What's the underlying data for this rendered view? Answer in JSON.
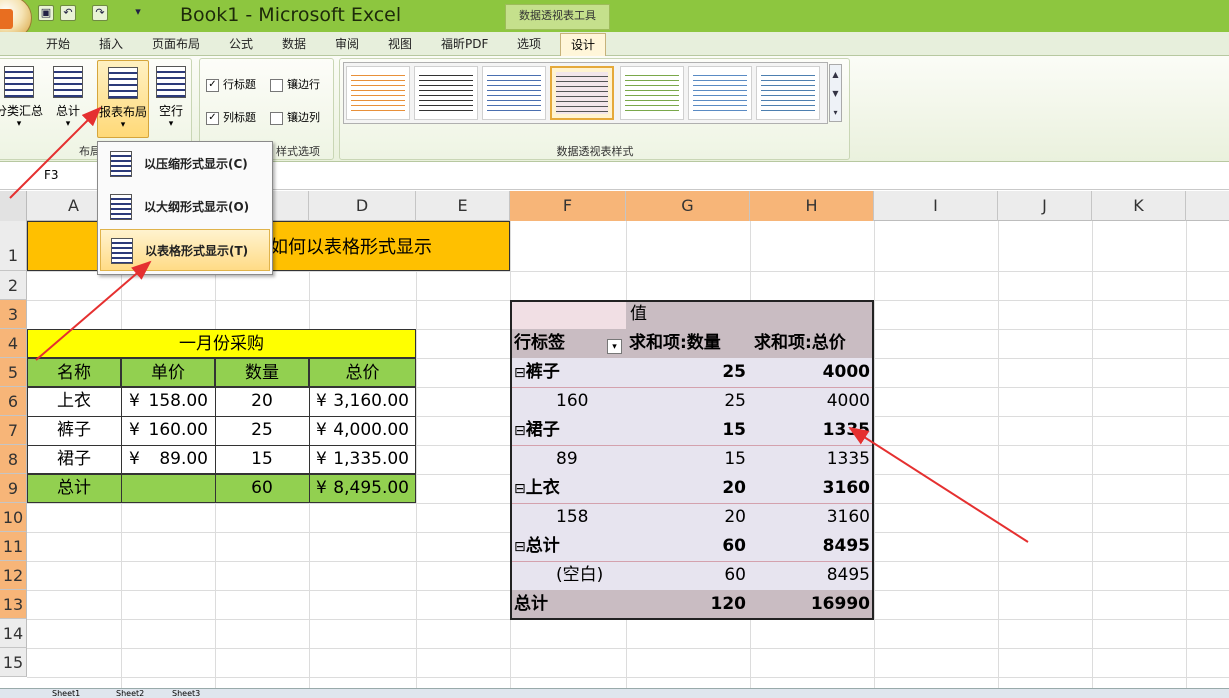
{
  "window": {
    "title": "Book1 - Microsoft Excel",
    "context_tool": "数据透视表工具"
  },
  "tabs": [
    "开始",
    "插入",
    "页面布局",
    "公式",
    "数据",
    "审阅",
    "视图",
    "福昕PDF",
    "选项",
    "设计"
  ],
  "ribbon": {
    "layout_buttons": [
      "分类汇总",
      "总计",
      "报表布局",
      "空行"
    ],
    "layout_group": "布局",
    "style_options": {
      "row_headers": "行标题",
      "banded_rows": "镶边行",
      "col_headers": "列标题",
      "banded_cols": "镶边列"
    },
    "style_options_group": "样式选项",
    "styles_group": "数据透视表样式"
  },
  "namebox": "F3",
  "columns": [
    "A",
    "B",
    "C",
    "D",
    "E",
    "F",
    "G",
    "H",
    "I",
    "J",
    "K"
  ],
  "rows": [
    "1",
    "2",
    "3",
    "4",
    "5",
    "6",
    "7",
    "8",
    "9",
    "10",
    "11",
    "12",
    "13",
    "14",
    "15"
  ],
  "dropdown": {
    "items": [
      "以压缩形式显示(C)",
      "以大纲形式显示(O)",
      "以表格形式显示(T)"
    ]
  },
  "banner": "如何以表格形式显示",
  "purchase": {
    "title": "一月份采购",
    "headers": [
      "名称",
      "单价",
      "数量",
      "总价"
    ],
    "rows": [
      {
        "name": "上衣",
        "price": "158.00",
        "qty": "20",
        "total": "3,160.00"
      },
      {
        "name": "裤子",
        "price": "160.00",
        "qty": "25",
        "total": "4,000.00"
      },
      {
        "name": "裙子",
        "price": "89.00",
        "qty": "15",
        "total": "1,335.00"
      }
    ],
    "total_label": "总计",
    "total_qty": "60",
    "total_value": "8,495.00",
    "currency": "¥"
  },
  "pivot": {
    "value_header": "值",
    "row_label": "行标签",
    "col1": "求和项:数量",
    "col2": "求和项:总价",
    "rows": [
      {
        "label": "裤子",
        "q": "25",
        "t": "4000",
        "group": true
      },
      {
        "label": "160",
        "q": "25",
        "t": "4000",
        "group": false
      },
      {
        "label": "裙子",
        "q": "15",
        "t": "1335",
        "group": true
      },
      {
        "label": "89",
        "q": "15",
        "t": "1335",
        "group": false
      },
      {
        "label": "上衣",
        "q": "20",
        "t": "3160",
        "group": true
      },
      {
        "label": "158",
        "q": "20",
        "t": "3160",
        "group": false
      },
      {
        "label": "总计",
        "q": "60",
        "t": "8495",
        "group": true
      },
      {
        "label": "(空白)",
        "q": "60",
        "t": "8495",
        "group": false
      }
    ],
    "grand_label": "总计",
    "grand_q": "120",
    "grand_t": "16990",
    "collapse_glyph": "⊟"
  },
  "sheets": [
    "Sheet1",
    "Sheet2",
    "Sheet3"
  ],
  "colors": {
    "orange": "#ffc000",
    "yellow": "#ffff00",
    "green": "#92d050",
    "pivot_head": "#c9bcc2"
  }
}
